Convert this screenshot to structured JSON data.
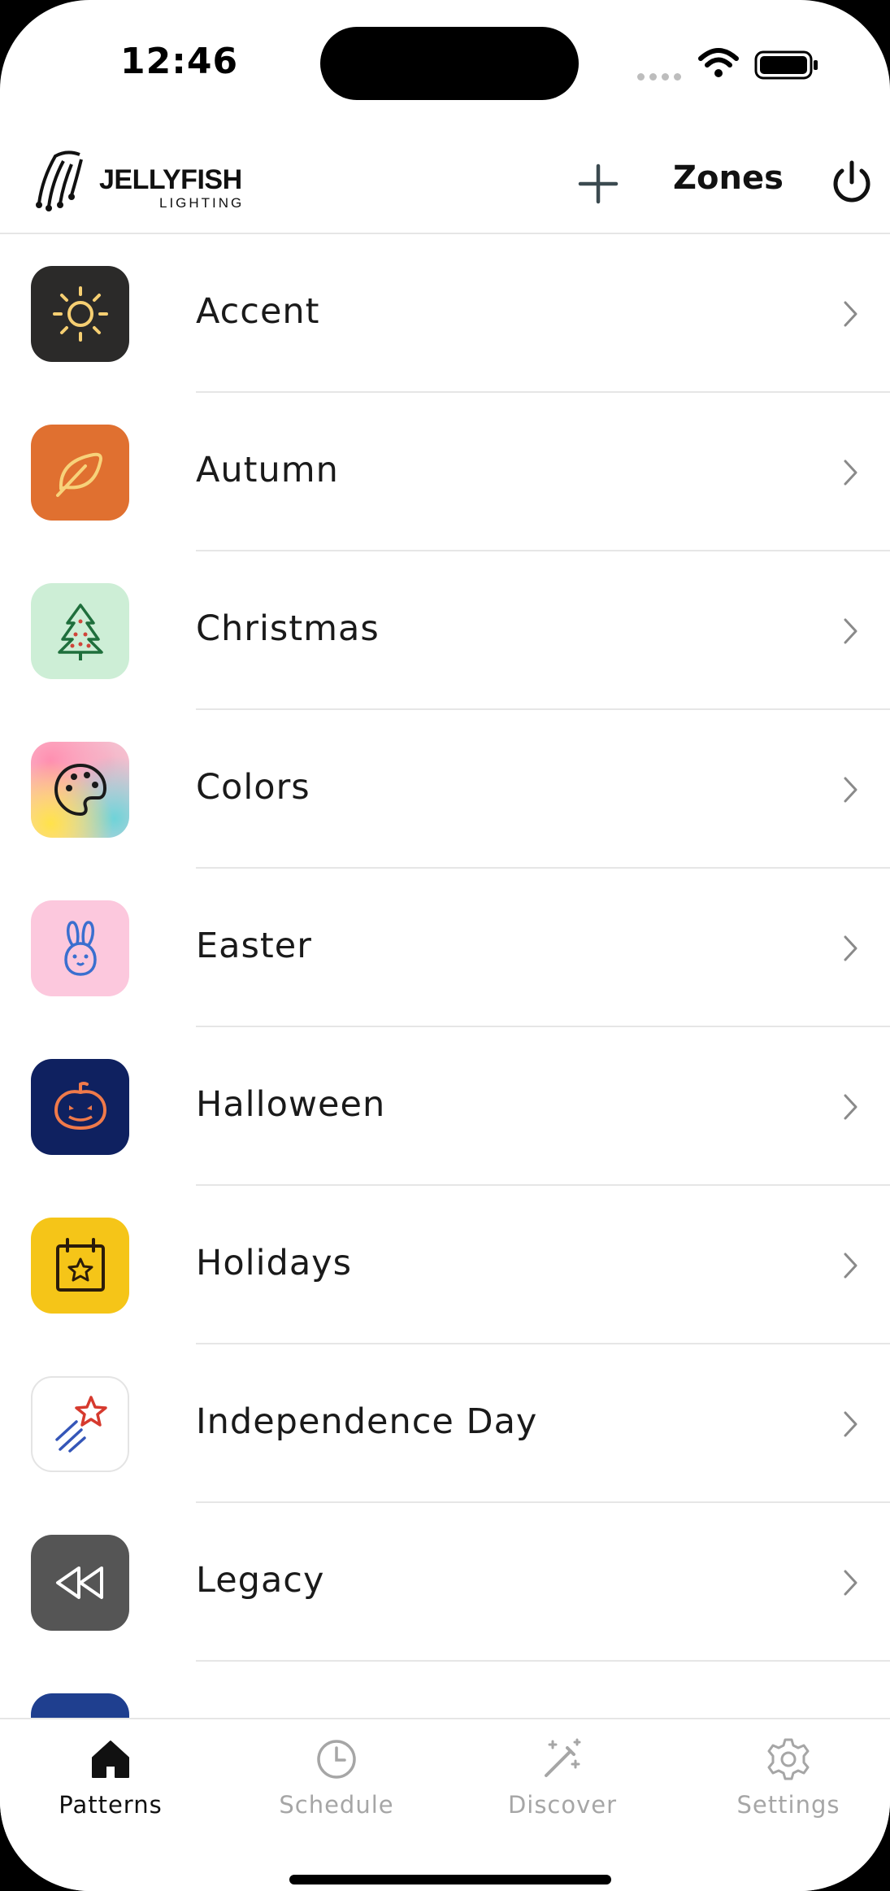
{
  "status_bar": {
    "time": "12:46"
  },
  "header": {
    "logo_text": "JELLYFISH",
    "logo_subtext": "LIGHTING",
    "add_icon": "plus-icon",
    "zones_label": "Zones",
    "power_icon": "power-icon"
  },
  "patterns": [
    {
      "label": "Accent",
      "icon": "sun-icon",
      "color": "#2b2a29"
    },
    {
      "label": "Autumn",
      "icon": "leaf-icon",
      "color": "#e07030"
    },
    {
      "label": "Christmas",
      "icon": "tree-icon",
      "color": "#cdeed6"
    },
    {
      "label": "Colors",
      "icon": "palette-icon",
      "color": "gradient"
    },
    {
      "label": "Easter",
      "icon": "bunny-icon",
      "color": "#fcc8dd"
    },
    {
      "label": "Halloween",
      "icon": "pumpkin-icon",
      "color": "#0f2160"
    },
    {
      "label": "Holidays",
      "icon": "calendar-star-icon",
      "color": "#f5c518"
    },
    {
      "label": "Independence Day",
      "icon": "shooting-star-icon",
      "color": "#ffffff"
    },
    {
      "label": "Legacy",
      "icon": "rewind-icon",
      "color": "#555555"
    }
  ],
  "tabs": [
    {
      "label": "Patterns",
      "icon": "home-icon",
      "active": true
    },
    {
      "label": "Schedule",
      "icon": "clock-icon",
      "active": false
    },
    {
      "label": "Discover",
      "icon": "magic-wand-icon",
      "active": false
    },
    {
      "label": "Settings",
      "icon": "gear-icon",
      "active": false
    }
  ]
}
